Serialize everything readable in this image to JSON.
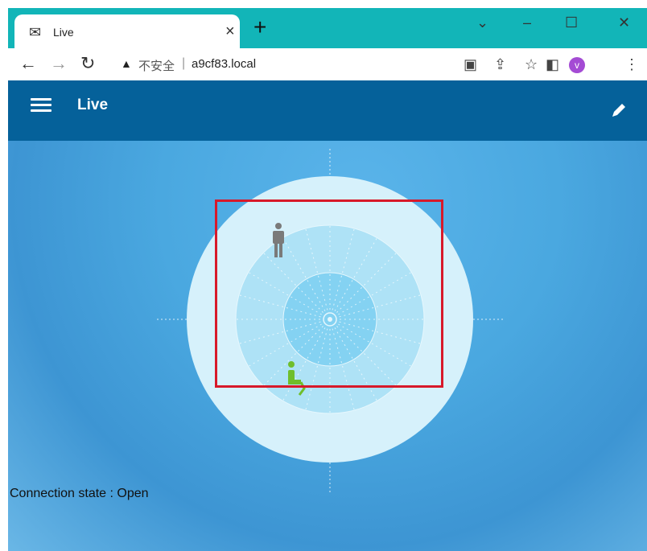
{
  "browser": {
    "tab_title": "Live",
    "insecure_label": "不安全",
    "separator": "|",
    "url": "a9cf83.local",
    "avatar_letter": "v",
    "avatar_color": "#a44bd4",
    "tabstrip_color": "#12b5b8"
  },
  "app": {
    "title": "Live",
    "header_color": "#05619a"
  },
  "status": {
    "connection": "Connection state : Open"
  },
  "targets": [
    {
      "name": "standing-person",
      "color": "#7a7a7a"
    },
    {
      "name": "seated-person",
      "color": "#6fbe2b"
    }
  ],
  "region_color": "#d7192a"
}
